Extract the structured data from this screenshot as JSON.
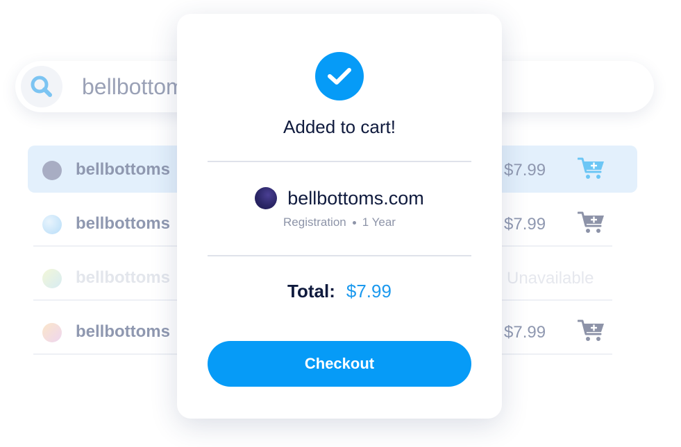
{
  "search": {
    "query": "bellbottoms",
    "icon": "search-icon"
  },
  "results": [
    {
      "name": "bellbottoms",
      "price": "$7.99",
      "status": "",
      "highlighted": true,
      "dot_color": "#a8adc3"
    },
    {
      "name": "bellbottoms",
      "price": "$7.99",
      "status": "",
      "highlighted": false,
      "dot_color": "#c9e6fb"
    },
    {
      "name": "bellbottoms",
      "price": "",
      "status": "Unavailable",
      "highlighted": false,
      "dot_color": "#e6f0d6"
    },
    {
      "name": "bellbottoms",
      "price": "$7.99",
      "status": "",
      "highlighted": false,
      "dot_color": "#f5d9e4"
    }
  ],
  "modal": {
    "title": "Added to cart!",
    "item": {
      "domain": "bellbottoms.com",
      "type": "Registration",
      "term": "1 Year"
    },
    "total_label": "Total:",
    "total_value": "$7.99",
    "checkout_label": "Checkout"
  },
  "colors": {
    "accent": "#069bf7",
    "price_blue": "#1b99ee",
    "text_dark": "#0f1a3d",
    "muted": "#8f98b0",
    "highlight_row": "#e3f0fc",
    "cart_active": "#6cc6f5",
    "cart_inactive": "#8d93a8"
  }
}
